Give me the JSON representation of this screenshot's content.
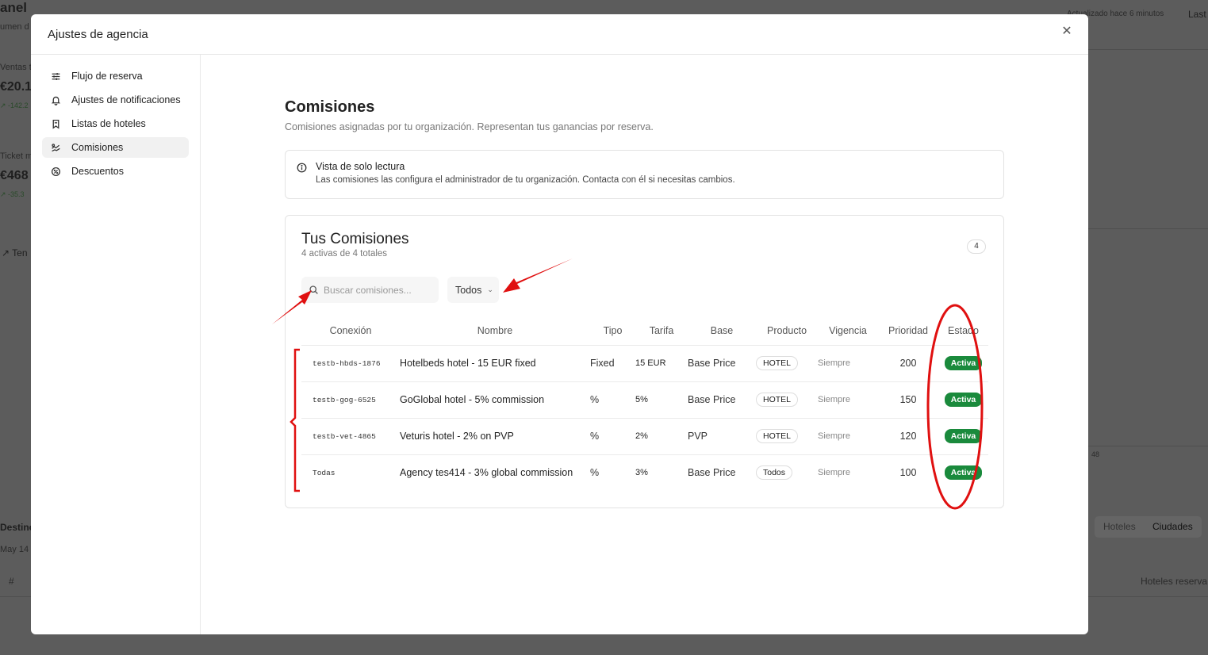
{
  "background": {
    "title": "anel",
    "subtitle": "umen d",
    "updated": "Actualizado hace 6 minutos",
    "last": "Last",
    "ventas_label": "Ventas t",
    "ventas_value": "€20.1",
    "ventas_delta": "↗ -142.2",
    "ticket_label": "Ticket m",
    "ticket_value": "€468",
    "ticket_delta": "↗ -35.3",
    "trend_label": "↗  Ten",
    "axis_tick": "48",
    "destino_label": "Destino",
    "date_label": "May 14 -",
    "hash": "#",
    "tab_hoteles": "Hoteles",
    "tab_ciudades": "Ciudades",
    "col_hoteles": "Hoteles reserva"
  },
  "modal": {
    "title": "Ajustes de agencia",
    "close_icon": "close-icon"
  },
  "sidebar": {
    "items": [
      {
        "label": "Flujo de reserva",
        "icon": "sliders-icon"
      },
      {
        "label": "Ajustes de notificaciones",
        "icon": "bell-icon"
      },
      {
        "label": "Listas de hoteles",
        "icon": "bookmark-icon"
      },
      {
        "label": "Comisiones",
        "icon": "commission-icon"
      },
      {
        "label": "Descuentos",
        "icon": "discount-icon"
      }
    ]
  },
  "page": {
    "title": "Comisiones",
    "subtitle": "Comisiones asignadas por tu organización. Representan tus ganancias por reserva."
  },
  "notice": {
    "title": "Vista de solo lectura",
    "text": "Las comisiones las configura el administrador de tu organización. Contacta con él si necesitas cambios."
  },
  "card": {
    "title": "Tus Comisiones",
    "subtitle": "4 activas de 4 totales",
    "count": "4"
  },
  "search": {
    "placeholder": "Buscar comisiones..."
  },
  "filter": {
    "selected": "Todos"
  },
  "table": {
    "headers": [
      "Conexión",
      "Nombre",
      "Tipo",
      "Tarifa",
      "Base",
      "Producto",
      "Vigencia",
      "Prioridad",
      "Estado"
    ],
    "rows": [
      {
        "conexion": "testb-hbds-1876",
        "nombre": "Hotelbeds hotel - 15 EUR fixed",
        "tipo": "Fixed",
        "tarifa": "15 EUR",
        "base": "Base Price",
        "producto": "HOTEL",
        "vigencia": "Siempre",
        "prioridad": "200",
        "estado": "Activa"
      },
      {
        "conexion": "testb-gog-6525",
        "nombre": "GoGlobal hotel - 5% commission",
        "tipo": "%",
        "tarifa": "5%",
        "base": "Base Price",
        "producto": "HOTEL",
        "vigencia": "Siempre",
        "prioridad": "150",
        "estado": "Activa"
      },
      {
        "conexion": "testb-vet-4865",
        "nombre": "Veturis hotel - 2% on PVP",
        "tipo": "%",
        "tarifa": "2%",
        "base": "PVP",
        "producto": "HOTEL",
        "vigencia": "Siempre",
        "prioridad": "120",
        "estado": "Activa"
      },
      {
        "conexion": "Todas",
        "nombre": "Agency tes414 - 3% global commission",
        "tipo": "%",
        "tarifa": "3%",
        "base": "Base Price",
        "producto": "Todos",
        "vigencia": "Siempre",
        "prioridad": "100",
        "estado": "Activa"
      }
    ]
  },
  "colors": {
    "status_active": "#1a8a3c",
    "annotation_red": "#e01010"
  }
}
